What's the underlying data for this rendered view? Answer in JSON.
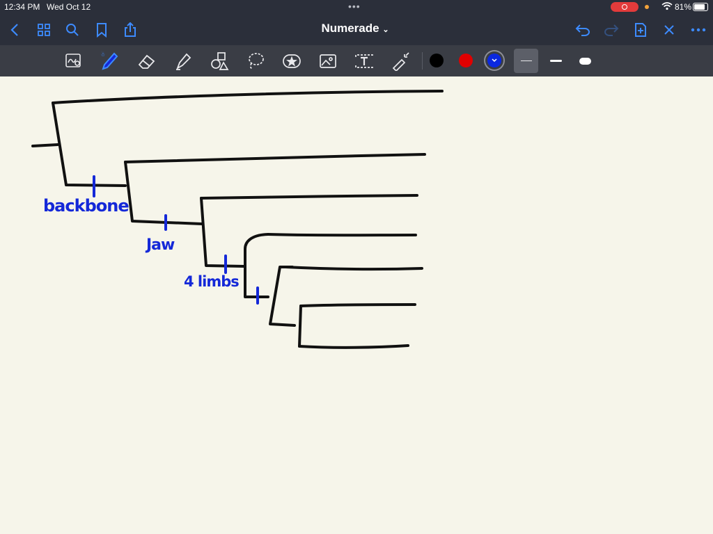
{
  "status": {
    "time": "12:34 PM",
    "date": "Wed Oct 12",
    "battery": "81%"
  },
  "nav": {
    "title": "Numerade",
    "icons": [
      "back-icon",
      "grid-icon",
      "search-icon",
      "bookmark-icon",
      "share-icon",
      "undo-icon",
      "redo-icon",
      "add-page-icon",
      "close-icon",
      "more-icon"
    ]
  },
  "toolbar": {
    "tools": [
      "zoom-pen-icon",
      "pen-icon",
      "eraser-icon",
      "highlighter-icon",
      "shapes-icon",
      "lasso-icon",
      "sticker-icon",
      "image-icon",
      "text-icon",
      "laser-icon"
    ],
    "colors": {
      "black": "#000000",
      "red": "#e00000",
      "blue": "#0a28e0"
    },
    "stroke_widths": [
      "thin",
      "medium",
      "thick"
    ]
  },
  "annotations": {
    "backbone": "backbone",
    "jaw": "Jaw",
    "limbs": "4 limbs"
  },
  "colors": {
    "ink": "#111111",
    "annotation": "#1428d8",
    "paper": "#f6f5ea",
    "accent": "#3d8bff"
  }
}
